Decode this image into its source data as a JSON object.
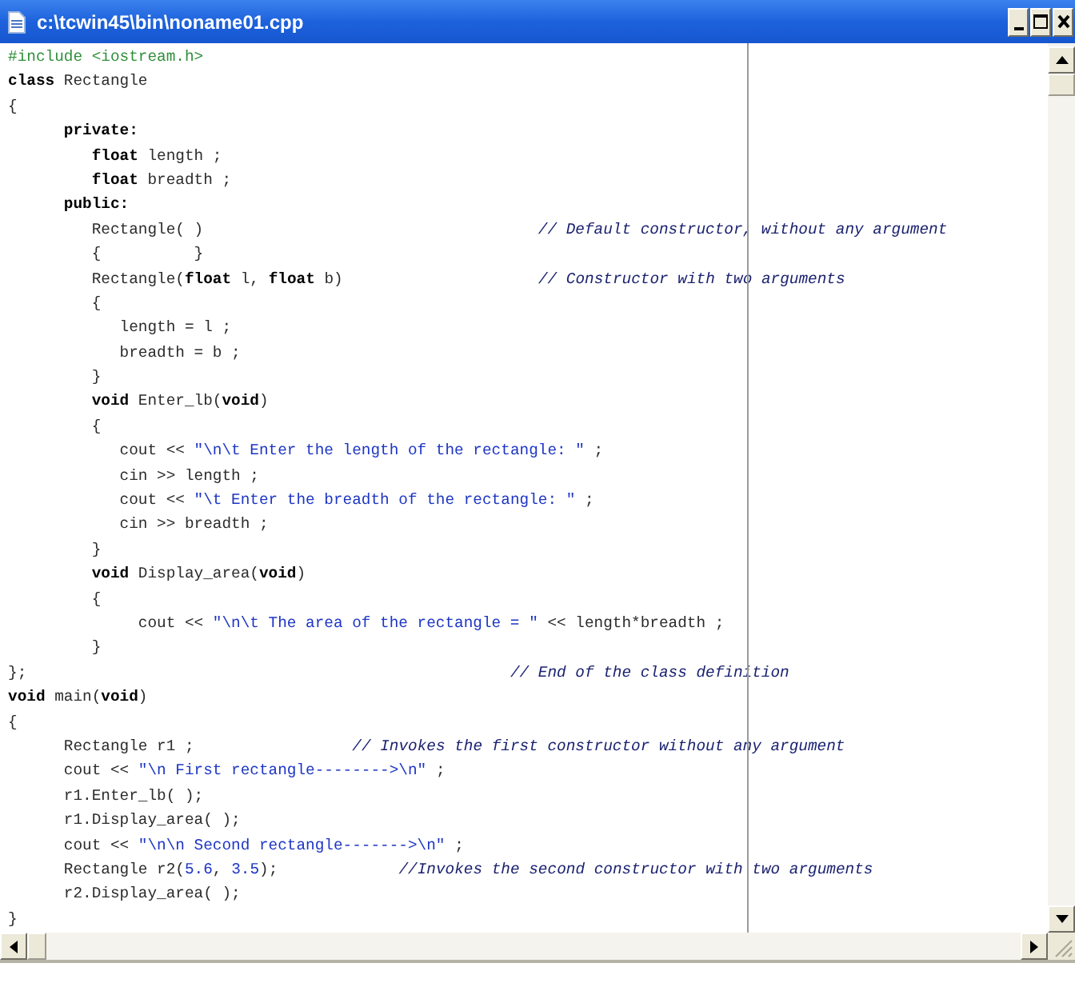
{
  "window": {
    "title": "c:\\tcwin45\\bin\\noname01.cpp"
  },
  "editor": {
    "lines": [
      {
        "segments": [
          {
            "kind": "preprocessor",
            "text": "#include <iostream.h>"
          }
        ]
      },
      {
        "segments": [
          {
            "kind": "keyword",
            "text": "class"
          },
          {
            "kind": "plain",
            "text": " Rectangle"
          }
        ]
      },
      {
        "segments": [
          {
            "kind": "plain",
            "text": "{"
          }
        ]
      },
      {
        "segments": [
          {
            "kind": "keyword",
            "text": "      private:"
          }
        ]
      },
      {
        "segments": [
          {
            "kind": "keyword",
            "text": "         float"
          },
          {
            "kind": "plain",
            "text": " length ;"
          }
        ]
      },
      {
        "segments": [
          {
            "kind": "keyword",
            "text": "         float"
          },
          {
            "kind": "plain",
            "text": " breadth ;"
          }
        ]
      },
      {
        "segments": [
          {
            "kind": "keyword",
            "text": "      public:"
          }
        ]
      },
      {
        "segments": [
          {
            "kind": "plain",
            "text": "         Rectangle( )"
          },
          {
            "kind": "comment",
            "text": "                                    // Default constructor, without any argument"
          }
        ]
      },
      {
        "segments": [
          {
            "kind": "plain",
            "text": "         {          }"
          }
        ]
      },
      {
        "segments": [
          {
            "kind": "plain",
            "text": "         Rectangle("
          },
          {
            "kind": "keyword",
            "text": "float"
          },
          {
            "kind": "plain",
            "text": " l, "
          },
          {
            "kind": "keyword",
            "text": "float"
          },
          {
            "kind": "plain",
            "text": " b)"
          },
          {
            "kind": "comment",
            "text": "                     // Constructor with two arguments"
          }
        ]
      },
      {
        "segments": [
          {
            "kind": "plain",
            "text": "         {"
          }
        ]
      },
      {
        "segments": [
          {
            "kind": "plain",
            "text": "            length = l ;"
          }
        ]
      },
      {
        "segments": [
          {
            "kind": "plain",
            "text": "            breadth = b ;"
          }
        ]
      },
      {
        "segments": [
          {
            "kind": "plain",
            "text": "         }"
          }
        ]
      },
      {
        "segments": [
          {
            "kind": "keyword",
            "text": "         void"
          },
          {
            "kind": "plain",
            "text": " Enter_lb("
          },
          {
            "kind": "keyword",
            "text": "void"
          },
          {
            "kind": "plain",
            "text": ")"
          }
        ]
      },
      {
        "segments": [
          {
            "kind": "plain",
            "text": "         {"
          }
        ]
      },
      {
        "segments": [
          {
            "kind": "plain",
            "text": "            cout << "
          },
          {
            "kind": "string",
            "text": "\"\\n\\t Enter the length of the rectangle: \""
          },
          {
            "kind": "plain",
            "text": " ;"
          }
        ]
      },
      {
        "segments": [
          {
            "kind": "plain",
            "text": "            cin >> length ;"
          }
        ]
      },
      {
        "segments": [
          {
            "kind": "plain",
            "text": "            cout << "
          },
          {
            "kind": "string",
            "text": "\"\\t Enter the breadth of the rectangle: \""
          },
          {
            "kind": "plain",
            "text": " ;"
          }
        ]
      },
      {
        "segments": [
          {
            "kind": "plain",
            "text": "            cin >> breadth ;"
          }
        ]
      },
      {
        "segments": [
          {
            "kind": "plain",
            "text": "         }"
          }
        ]
      },
      {
        "segments": [
          {
            "kind": "keyword",
            "text": "         void"
          },
          {
            "kind": "plain",
            "text": " Display_area("
          },
          {
            "kind": "keyword",
            "text": "void"
          },
          {
            "kind": "plain",
            "text": ")"
          }
        ]
      },
      {
        "segments": [
          {
            "kind": "plain",
            "text": "         {"
          }
        ]
      },
      {
        "segments": [
          {
            "kind": "plain",
            "text": "              cout << "
          },
          {
            "kind": "string",
            "text": "\"\\n\\t The area of the rectangle = \""
          },
          {
            "kind": "plain",
            "text": " << length*breadth ;"
          }
        ]
      },
      {
        "segments": [
          {
            "kind": "plain",
            "text": "         }"
          }
        ]
      },
      {
        "segments": [
          {
            "kind": "plain",
            "text": "};"
          },
          {
            "kind": "comment",
            "text": "                                                    // End of the class definition"
          }
        ]
      },
      {
        "segments": [
          {
            "kind": "keyword",
            "text": "void"
          },
          {
            "kind": "plain",
            "text": " main("
          },
          {
            "kind": "keyword",
            "text": "void"
          },
          {
            "kind": "plain",
            "text": ")"
          }
        ]
      },
      {
        "segments": [
          {
            "kind": "plain",
            "text": "{"
          }
        ]
      },
      {
        "segments": [
          {
            "kind": "plain",
            "text": "      Rectangle r1 ;"
          },
          {
            "kind": "comment",
            "text": "                 // Invokes the first constructor without any argument"
          }
        ]
      },
      {
        "segments": [
          {
            "kind": "plain",
            "text": "      cout << "
          },
          {
            "kind": "string",
            "text": "\"\\n First rectangle-------->\\n\""
          },
          {
            "kind": "plain",
            "text": " ;"
          }
        ]
      },
      {
        "segments": [
          {
            "kind": "plain",
            "text": "      r1.Enter_lb( );"
          }
        ]
      },
      {
        "segments": [
          {
            "kind": "plain",
            "text": "      r1.Display_area( );"
          }
        ]
      },
      {
        "segments": [
          {
            "kind": "plain",
            "text": "      cout << "
          },
          {
            "kind": "string",
            "text": "\"\\n\\n Second rectangle------->\\n\""
          },
          {
            "kind": "plain",
            "text": " ;"
          }
        ]
      },
      {
        "segments": [
          {
            "kind": "plain",
            "text": "      Rectangle r2("
          },
          {
            "kind": "number",
            "text": "5.6"
          },
          {
            "kind": "plain",
            "text": ", "
          },
          {
            "kind": "number",
            "text": "3.5"
          },
          {
            "kind": "plain",
            "text": ");"
          },
          {
            "kind": "comment",
            "text": "             //Invokes the second constructor with two arguments"
          }
        ]
      },
      {
        "segments": [
          {
            "kind": "plain",
            "text": "      r2.Display_area( );"
          }
        ]
      },
      {
        "segments": [
          {
            "kind": "plain",
            "text": "}"
          }
        ]
      }
    ]
  }
}
